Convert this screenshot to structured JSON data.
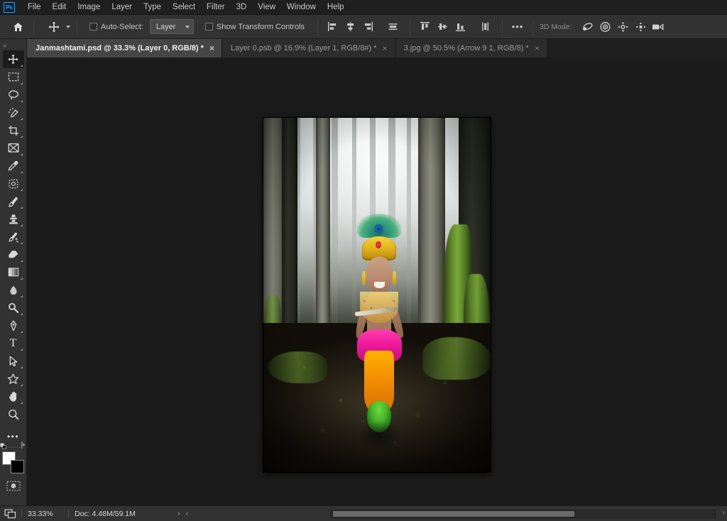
{
  "app": {
    "name": "Adobe Photoshop",
    "logo_text": "Ps"
  },
  "menubar": {
    "items": [
      {
        "label": "File"
      },
      {
        "label": "Edit"
      },
      {
        "label": "Image"
      },
      {
        "label": "Layer"
      },
      {
        "label": "Type"
      },
      {
        "label": "Select"
      },
      {
        "label": "Filter"
      },
      {
        "label": "3D"
      },
      {
        "label": "View"
      },
      {
        "label": "Window"
      },
      {
        "label": "Help"
      }
    ]
  },
  "options_bar": {
    "home_icon": "home-icon",
    "active_tool_icon": "move-tool-icon",
    "auto_select_label": "Auto-Select:",
    "auto_select_checked": false,
    "layer_dropdown_value": "Layer",
    "show_transform_label": "Show Transform Controls",
    "show_transform_checked": false,
    "align_horizontal": [
      {
        "name": "align-left-edges",
        "icon": "align-left-icon"
      },
      {
        "name": "align-horizontal-centers",
        "icon": "align-center-icon"
      },
      {
        "name": "align-right-edges",
        "icon": "align-right-icon"
      }
    ],
    "distribute": [
      {
        "name": "distribute-horizontal",
        "icon": "distribute-icon"
      }
    ],
    "align_vertical": [
      {
        "name": "align-top-edges",
        "icon": "align-top-icon"
      },
      {
        "name": "align-vertical-centers",
        "icon": "align-middle-icon"
      },
      {
        "name": "align-bottom-edges",
        "icon": "align-bottom-icon"
      }
    ],
    "distribute_vertical": [
      {
        "name": "distribute-vertical",
        "icon": "distribute-vertical-icon"
      }
    ],
    "more_options_label": "•••",
    "mode3d_label": "3D Mode:",
    "mode3d_icons": [
      {
        "name": "orbit-3d-icon"
      },
      {
        "name": "roll-3d-icon"
      },
      {
        "name": "pan-3d-icon"
      },
      {
        "name": "slide-3d-icon"
      },
      {
        "name": "camera-3d-icon"
      }
    ]
  },
  "tabs": [
    {
      "label": "Janmashtami.psd @ 33.3% (Layer 0, RGB/8) *",
      "active": true,
      "close_icon": "×"
    },
    {
      "label": "Layer 0.psb @ 16.9% (Layer 1, RGB/8#) *",
      "active": false,
      "close_icon": "×"
    },
    {
      "label": "3.jpg @ 50.5% (Arrow 9 1, RGB/8) *",
      "active": false,
      "close_icon": "×"
    }
  ],
  "toolbar": {
    "expand_label": "»",
    "tools": [
      {
        "name": "move-tool",
        "icon": "move-icon",
        "selected": true
      },
      {
        "name": "rectangular-marquee-tool",
        "icon": "marquee-icon",
        "selected": false
      },
      {
        "name": "lasso-tool",
        "icon": "lasso-icon",
        "selected": false
      },
      {
        "name": "quick-selection-tool",
        "icon": "quick-selection-icon",
        "selected": false
      },
      {
        "name": "crop-tool",
        "icon": "crop-icon",
        "selected": false
      },
      {
        "name": "frame-tool",
        "icon": "frame-icon",
        "selected": false
      },
      {
        "name": "eyedropper-tool",
        "icon": "eyedropper-icon",
        "selected": false
      },
      {
        "name": "spot-healing-brush-tool",
        "icon": "healing-brush-icon",
        "selected": false
      },
      {
        "name": "brush-tool",
        "icon": "brush-icon",
        "selected": false
      },
      {
        "name": "clone-stamp-tool",
        "icon": "clone-stamp-icon",
        "selected": false
      },
      {
        "name": "history-brush-tool",
        "icon": "history-brush-icon",
        "selected": false
      },
      {
        "name": "eraser-tool",
        "icon": "eraser-icon",
        "selected": false
      },
      {
        "name": "gradient-tool",
        "icon": "gradient-icon",
        "selected": false
      },
      {
        "name": "blur-tool",
        "icon": "blur-icon",
        "selected": false
      },
      {
        "name": "dodge-tool",
        "icon": "dodge-icon",
        "selected": false
      },
      {
        "name": "pen-tool",
        "icon": "pen-icon",
        "selected": false
      },
      {
        "name": "type-tool",
        "icon": "type-icon",
        "selected": false
      },
      {
        "name": "path-selection-tool",
        "icon": "path-selection-icon",
        "selected": false
      },
      {
        "name": "custom-shape-tool",
        "icon": "shape-icon",
        "selected": false
      },
      {
        "name": "hand-tool",
        "icon": "hand-icon",
        "selected": false
      },
      {
        "name": "zoom-tool",
        "icon": "zoom-icon",
        "selected": false
      },
      {
        "name": "edit-toolbar",
        "icon": "ellipsis-icon",
        "selected": false
      }
    ],
    "type_tool_glyph": "T",
    "ellipsis_glyph": "•••",
    "swap_colors_glyph": "↱",
    "foreground_color": "#ffffff",
    "background_color": "#000000",
    "quick_mask_name": "quick-mask-mode"
  },
  "canvas": {
    "document_name": "Janmashtami.psd",
    "zoom_percent": "33.3%",
    "artwork_description": "Child dressed as Krishna with peacock-feather crown and flute standing among mossy trees in a misty forest"
  },
  "status_bar": {
    "screen_mode_icon": "screen-mode-icon",
    "zoom_level": "33.33%",
    "doc_info": "Doc: 4.48M/59.1M",
    "expand_arrow": "›",
    "collapse_arrow": "‹",
    "scroll_right_arrow": "›"
  },
  "colors": {
    "panel_bg": "#323232",
    "menu_bg": "#1f1f1f",
    "workspace_bg": "#1b1b1b",
    "tab_active_bg": "#454545",
    "tab_inactive_bg": "#2c2c2c",
    "text_primary": "#d6d6d6",
    "accent_blue": "#31a8ff"
  }
}
